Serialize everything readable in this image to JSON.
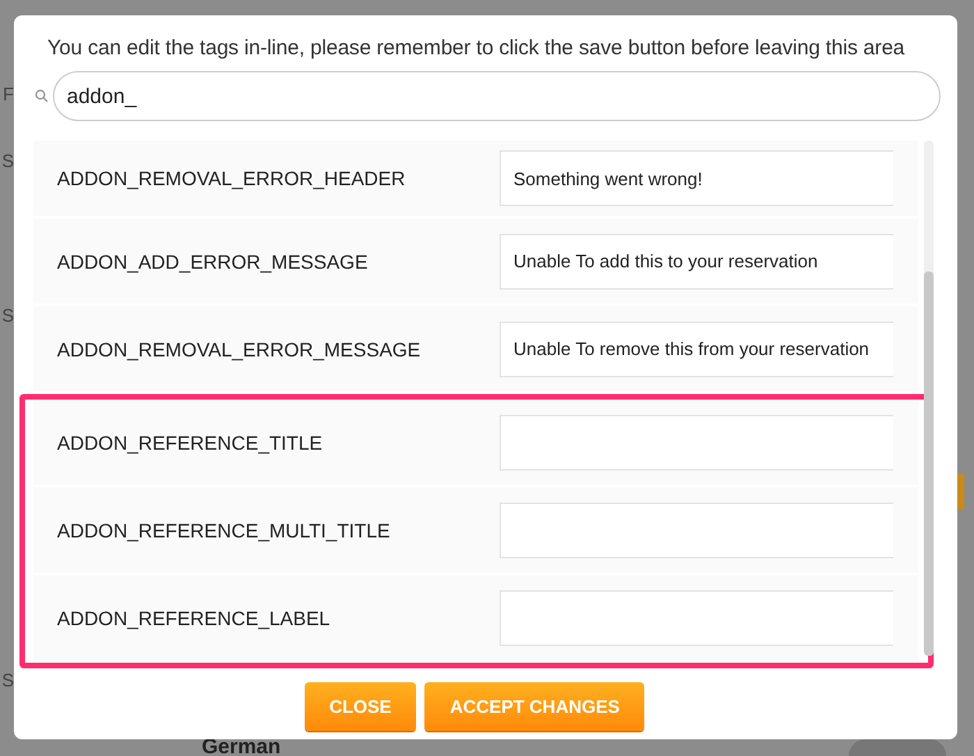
{
  "background": {
    "side_labels": [
      "F",
      "S",
      "S",
      "S"
    ],
    "language_row": {
      "label": "German",
      "on": false
    }
  },
  "modal": {
    "instructions": "You can edit the tags in-line, please remember to click the save button before leaving this area",
    "search": {
      "value": "addon_"
    },
    "rows": [
      {
        "key": "ADDON_REMOVAL_ERROR_HEADER",
        "value": "Something went wrong!",
        "highlighted": false
      },
      {
        "key": "ADDON_ADD_ERROR_MESSAGE",
        "value": "Unable To add this to your reservation",
        "highlighted": false
      },
      {
        "key": "ADDON_REMOVAL_ERROR_MESSAGE",
        "value": "Unable To remove this from your reservation",
        "highlighted": false
      },
      {
        "key": "ADDON_REFERENCE_TITLE",
        "highlighted": true
      },
      {
        "key": "ADDON_REFERENCE_MULTI_TITLE",
        "highlighted": true
      },
      {
        "key": "ADDON_REFERENCE_LABEL",
        "highlighted": true
      }
    ],
    "buttons": [
      "CLOSE",
      "ACCEPT CHANGES"
    ]
  }
}
